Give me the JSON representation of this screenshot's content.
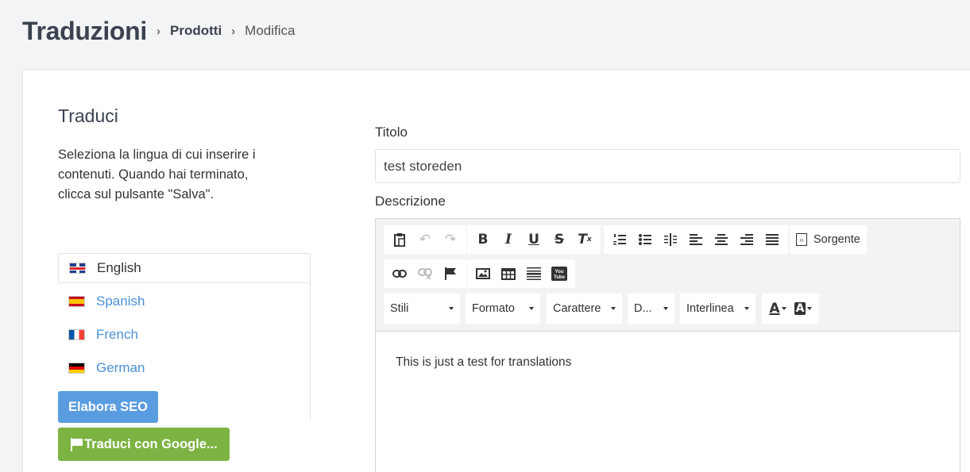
{
  "header": {
    "title": "Traduzioni",
    "breadcrumb": [
      "Prodotti",
      "Modifica"
    ]
  },
  "left": {
    "section_title": "Traduci",
    "help_text": "Seleziona la lingua di cui inserire i contenuti. Quando hai terminato, clicca sul pulsante \"Salva\".",
    "languages": [
      {
        "label": "English",
        "flag": "uk-flag-icon",
        "active": true
      },
      {
        "label": "Spanish",
        "flag": "es-flag-icon",
        "active": false
      },
      {
        "label": "French",
        "flag": "fr-flag-icon",
        "active": false
      },
      {
        "label": "German",
        "flag": "de-flag-icon",
        "active": false
      }
    ],
    "seo_button": "Elabora SEO",
    "google_button": "Traduci con Google..."
  },
  "form": {
    "title_label": "Titolo",
    "title_value": "test storeden",
    "description_label": "Descrizione",
    "source_label": "Sorgente",
    "combos": {
      "styles": "Stili",
      "format": "Formato",
      "font": "Carattere",
      "size": "D...",
      "line_height": "Interlinea"
    },
    "content": "This is just a test for translations"
  },
  "colors": {
    "link": "#4a90d9",
    "seo_button": "#5a9ce0",
    "google_button": "#7cb342",
    "title_text": "#3b4350"
  }
}
